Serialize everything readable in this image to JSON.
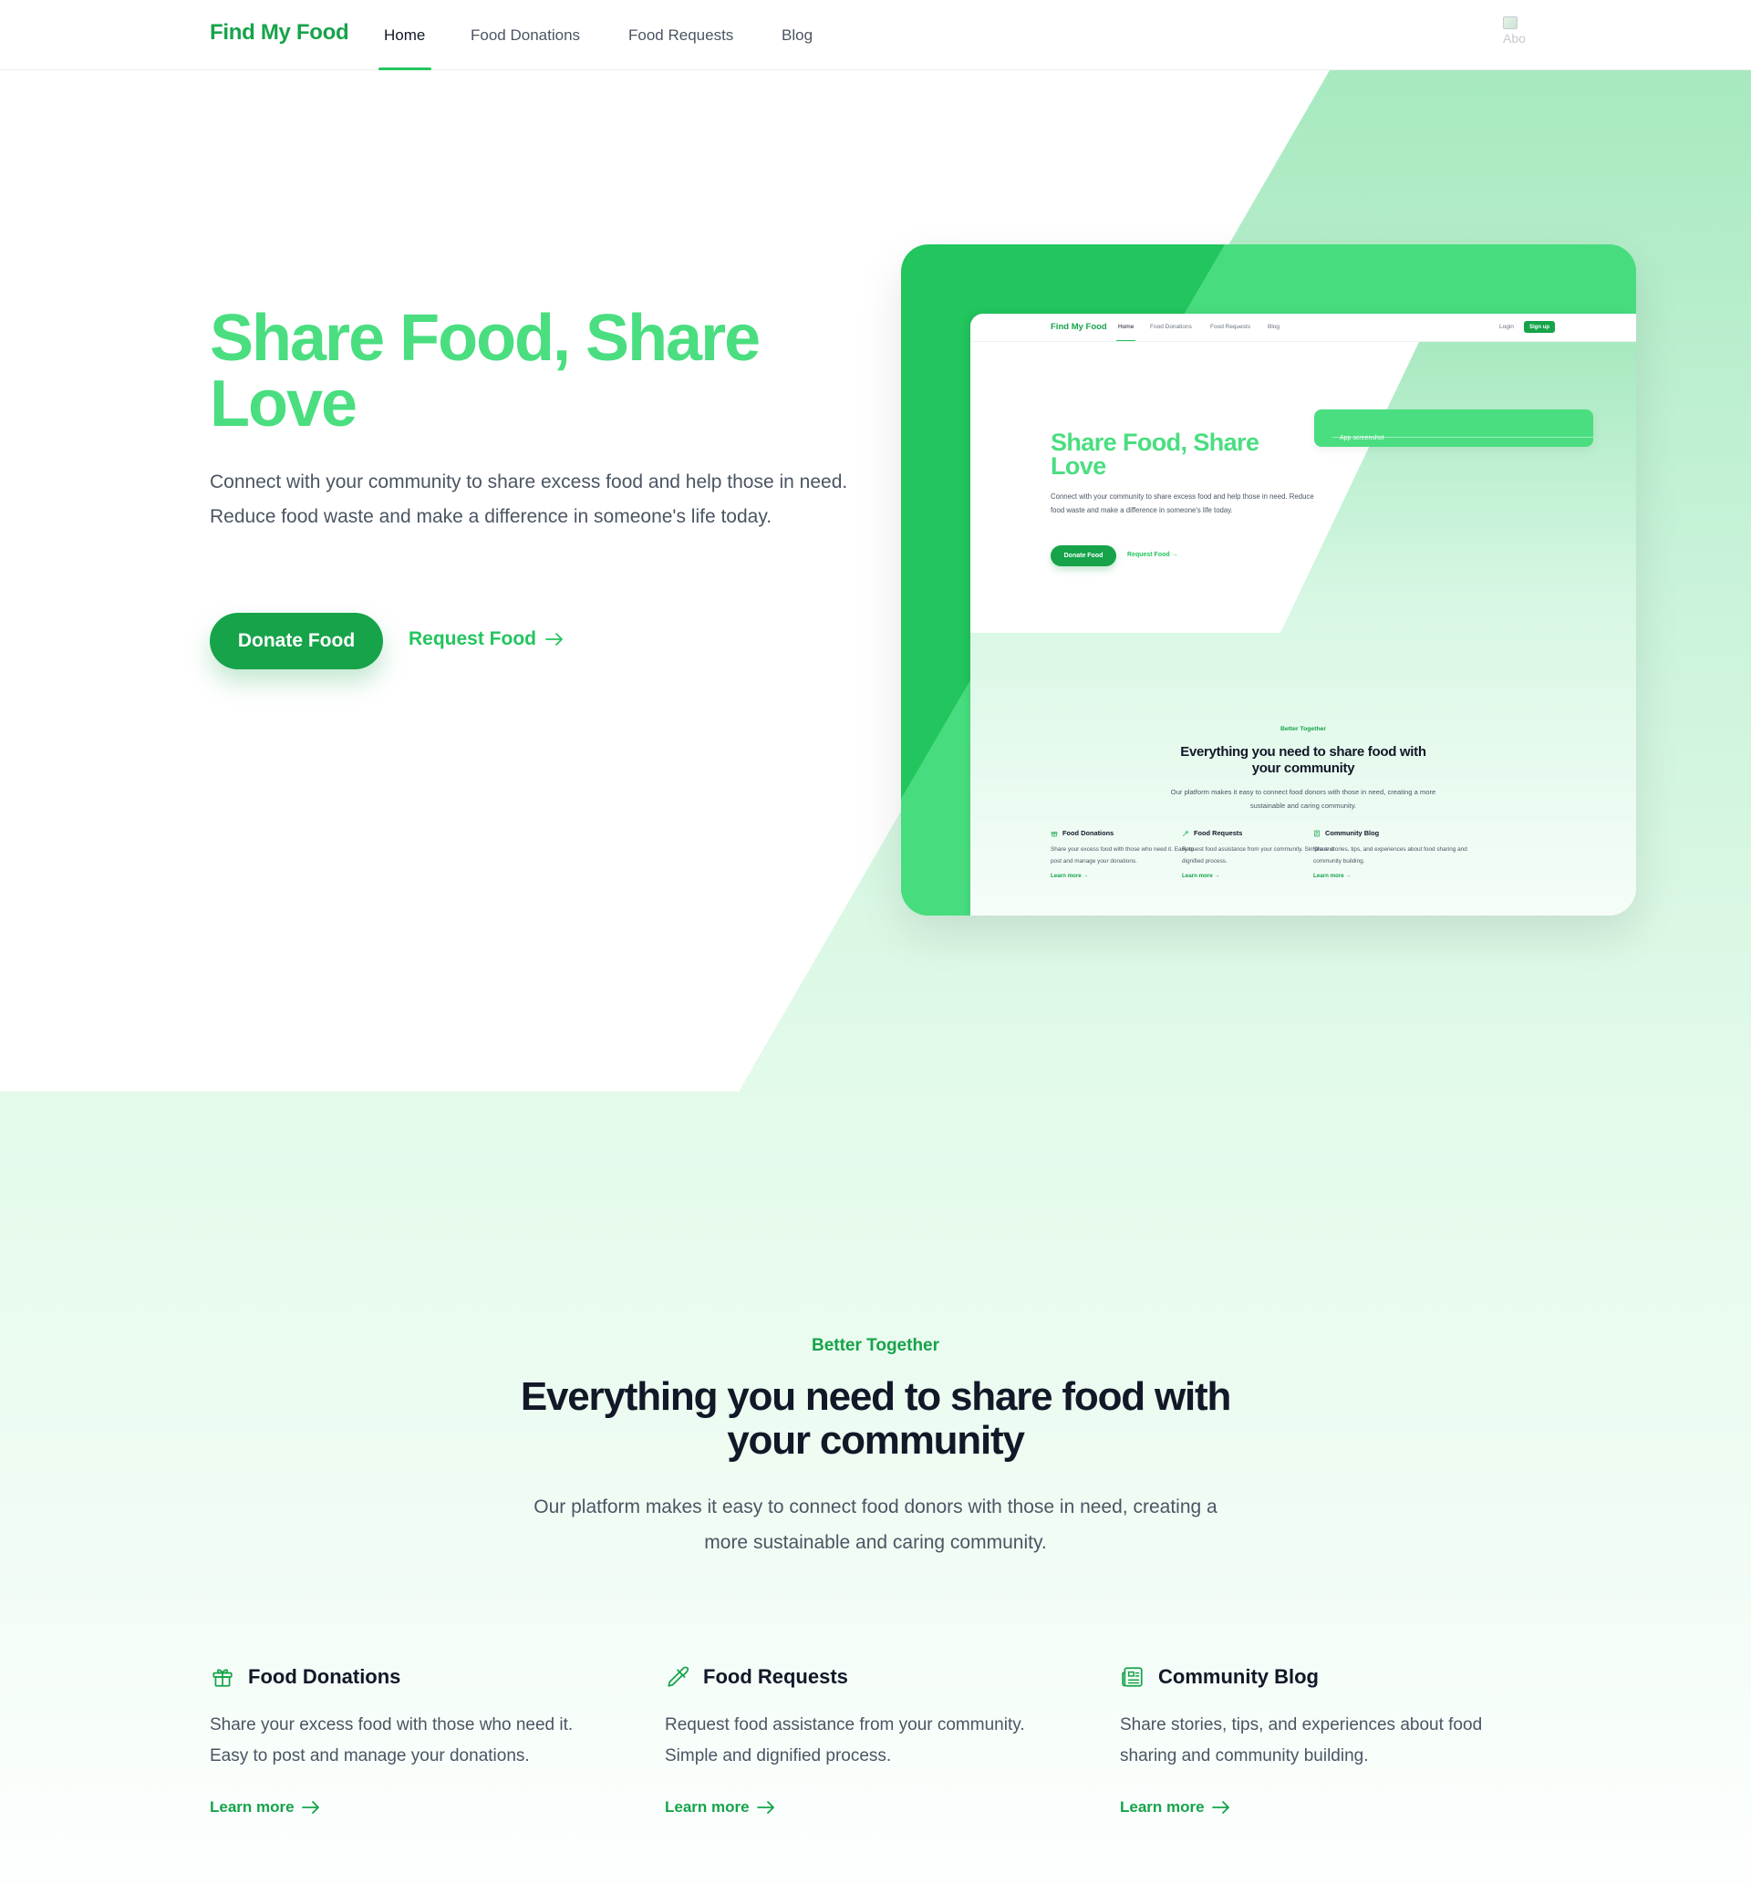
{
  "brand": {
    "name": "Find My Food"
  },
  "nav": {
    "items": [
      {
        "label": "Home",
        "active": true
      },
      {
        "label": "Food Donations",
        "active": false
      },
      {
        "label": "Food Requests",
        "active": false
      },
      {
        "label": "Blog",
        "active": false
      }
    ],
    "avatar_alt": "Abo"
  },
  "hero": {
    "title": "Share Food, Share Love",
    "description": "Connect with your community to share excess food and help those in need. Reduce food waste and make a difference in someone's life today.",
    "primary_button": "Donate Food",
    "secondary_button": "Request Food"
  },
  "screenshot": {
    "brand": "Find My Food",
    "nav": [
      "Home",
      "Food Donations",
      "Food Requests",
      "Blog"
    ],
    "login": "Login",
    "signup": "Sign up",
    "title": "Share Food, Share Love",
    "description": "Connect with your community to share excess food and help those in need. Reduce food waste and make a difference in someone's life today.",
    "primary_button": "Donate Food",
    "secondary_button": "Request Food →",
    "image_alt": "App screenshot",
    "eyebrow": "Better Together",
    "heading": "Everything you need to share food with your community",
    "subheading": "Our platform makes it easy to connect food donors with those in need, creating a more sustainable and caring community.",
    "features": [
      {
        "title": "Food Donations",
        "description": "Share your excess food with those who need it. Easy to post and manage your donations.",
        "link": "Learn more →"
      },
      {
        "title": "Food Requests",
        "description": "Request food assistance from your community. Simple and dignified process.",
        "link": "Learn more →"
      },
      {
        "title": "Community Blog",
        "description": "Share stories, tips, and experiences about food sharing and community building.",
        "link": "Learn more →"
      }
    ]
  },
  "features": {
    "eyebrow": "Better Together",
    "heading": "Everything you need to share food with your community",
    "subheading": "Our platform makes it easy to connect food donors with those in need, creating a more sustainable and caring community.",
    "items": [
      {
        "icon": "gift-icon",
        "title": "Food Donations",
        "description": "Share your excess food with those who need it. Easy to post and manage your donations.",
        "link": "Learn more"
      },
      {
        "icon": "pipette-icon",
        "title": "Food Requests",
        "description": "Request food assistance from your community. Simple and dignified process.",
        "link": "Learn more"
      },
      {
        "icon": "newspaper-icon",
        "title": "Community Blog",
        "description": "Share stories, tips, and experiences about food sharing and community building.",
        "link": "Learn more"
      }
    ]
  },
  "colors": {
    "brand": "#16a34a",
    "accent": "#22c55e",
    "light_accent": "#4ade80",
    "text": "#111827",
    "muted": "#4b5563"
  }
}
